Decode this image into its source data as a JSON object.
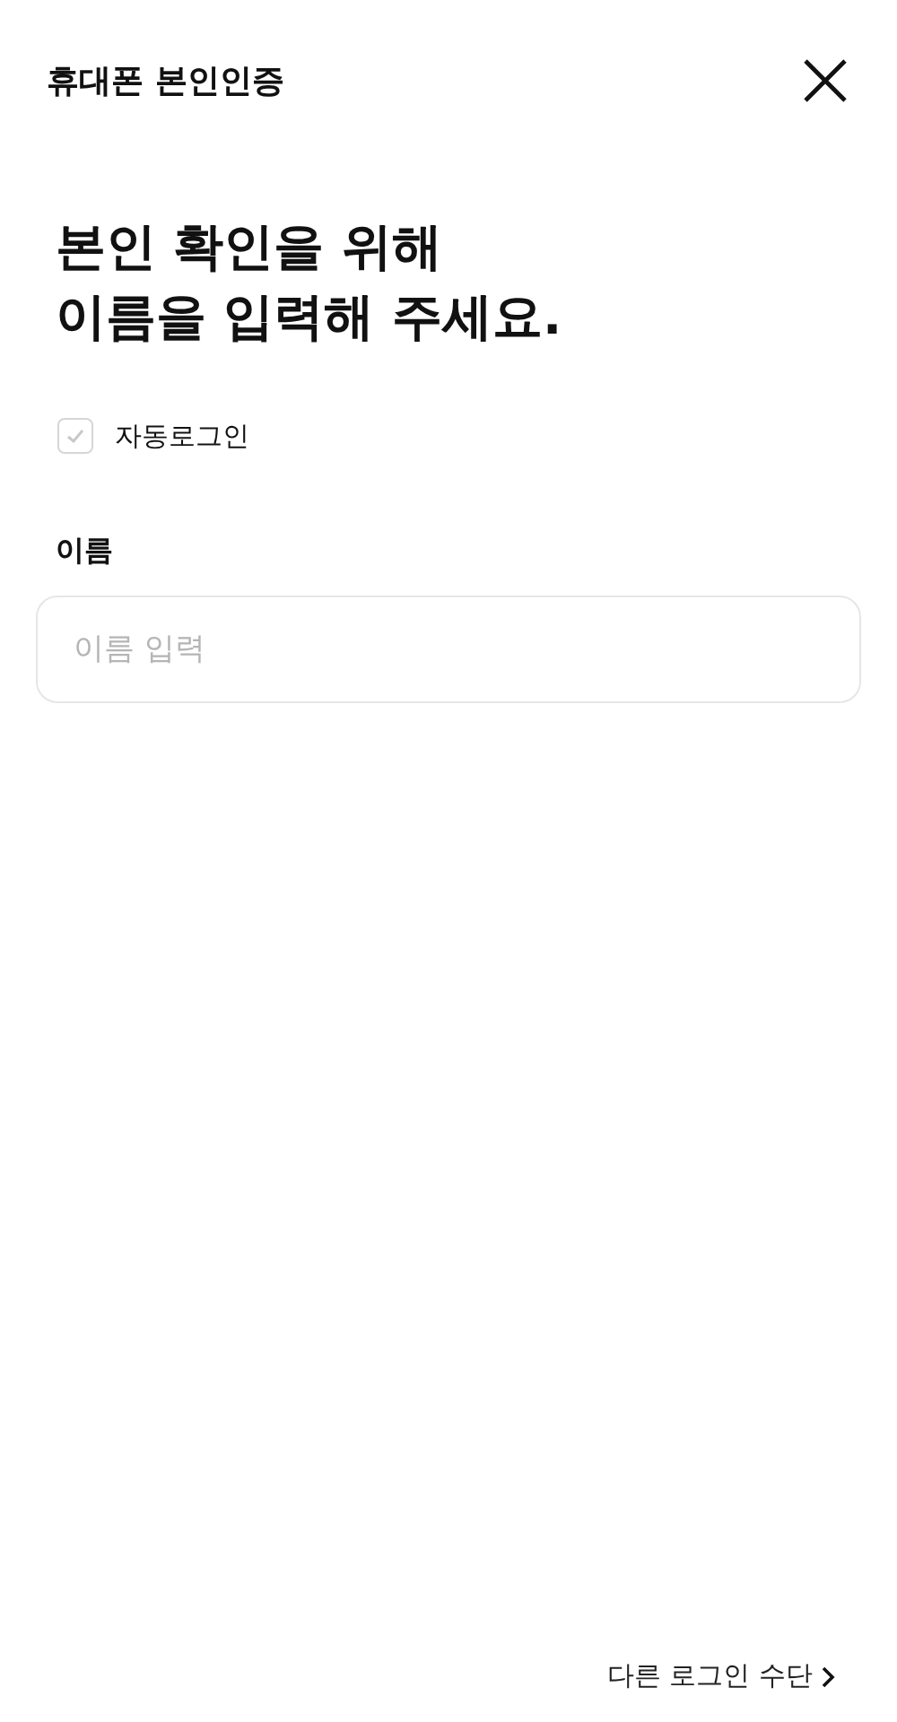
{
  "header": {
    "title": "휴대폰 본인인증"
  },
  "heading": [
    "본인 확인을 위해",
    "이름을 입력해 주세요."
  ],
  "auto_login": {
    "label": "자동로그인",
    "checked": false
  },
  "name_field": {
    "label": "이름",
    "placeholder": "이름 입력"
  },
  "other_login": {
    "label": "다른 로그인 수단"
  }
}
